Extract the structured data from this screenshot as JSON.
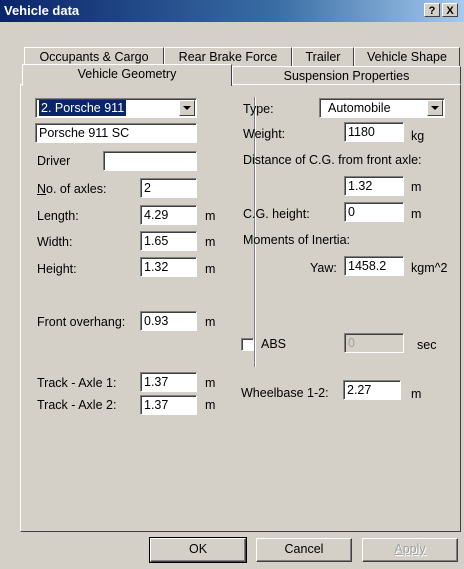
{
  "window": {
    "title": "Vehicle data",
    "help_label": "?",
    "close_label": "X"
  },
  "tabs": {
    "row1": [
      "Occupants & Cargo",
      "Rear Brake Force",
      "Trailer",
      "Vehicle Shape"
    ],
    "row2": [
      "Vehicle Geometry",
      "Suspension Properties"
    ],
    "active": "Vehicle Geometry"
  },
  "left": {
    "vehicle_select": "2. Porsche 911",
    "vehicle_name": "Porsche 911 SC",
    "driver_label": "Driver",
    "driver_value": "",
    "axles_label_u": "N",
    "axles_label_rest": "o. of axles:",
    "axles_value": "2",
    "length_label": "Length:",
    "length_value": "4.29",
    "length_unit": "m",
    "width_label": "Width:",
    "width_value": "1.65",
    "width_unit": "m",
    "height_label": "Height:",
    "height_value": "1.32",
    "height_unit": "m",
    "front_overhang_label": "Front overhang:",
    "front_overhang_value": "0.93",
    "front_overhang_unit": "m",
    "track1_label": "Track - Axle 1:",
    "track1_value": "1.37",
    "track1_unit": "m",
    "track2_label": "Track - Axle 2:",
    "track2_value": "1.37",
    "track2_unit": "m"
  },
  "right": {
    "type_label": "Type:",
    "type_value": "Automobile",
    "weight_label": "Weight:",
    "weight_value": "1180",
    "weight_unit": "kg",
    "cg_front_label": "Distance of C.G. from front axle:",
    "cg_front_value": "1.32",
    "cg_front_unit": "m",
    "cg_height_label": "C.G. height:",
    "cg_height_value": "0",
    "cg_height_unit": "m",
    "moments_label": "Moments of Inertia:",
    "yaw_label": "Yaw:",
    "yaw_value": "1458.2",
    "yaw_unit": "kgm^2",
    "abs_label": "ABS",
    "abs_value": "0",
    "abs_unit": "sec",
    "wheelbase_label": "Wheelbase 1-2:",
    "wheelbase_value": "2.27",
    "wheelbase_unit": "m"
  },
  "buttons": {
    "ok": "OK",
    "cancel": "Cancel",
    "apply": "Apply"
  }
}
